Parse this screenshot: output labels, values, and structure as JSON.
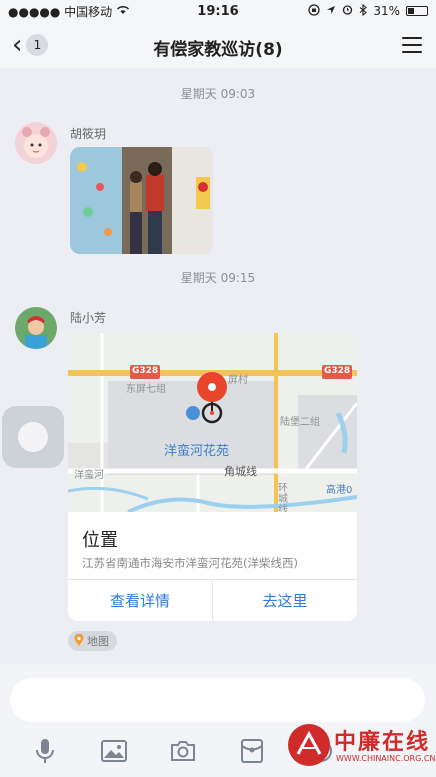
{
  "status_bar": {
    "carrier": "●●●●● 中国移动",
    "time": "19:16",
    "battery_text": "31%",
    "battery_level": 0.31
  },
  "nav": {
    "back_count": "1",
    "title": "有偿家教巡访(8)"
  },
  "messages": [
    {
      "time": "星期天 09:03",
      "sender": "胡筱玥",
      "type": "image"
    },
    {
      "time": "星期天 09:15",
      "sender": "陆小芳",
      "type": "location",
      "location": {
        "title": "位置",
        "address": "江苏省南通市海安市洋蛮河花苑(洋柴线西)",
        "view_details": "查看详情",
        "go_here": "去这里",
        "map_labels": {
          "road_1": "G328",
          "road_2": "G328",
          "village_1": "东屏七组",
          "village_2": "屏村",
          "poi": "洋蛮河花苑",
          "area_1": "陆堡二组",
          "area_2": "洋蛮河",
          "street_1": "角城线",
          "street_2": "环城线",
          "road_3": "高港0"
        }
      },
      "tag": "地图"
    }
  ],
  "input": {
    "placeholder": ""
  },
  "toolbar": [
    "microphone-icon",
    "image-icon",
    "camera-icon",
    "red-packet-icon",
    "emoji-icon"
  ],
  "watermark": {
    "name": "中廉在线",
    "url": "WWW.CHINAINC.ORG.CN"
  },
  "colors": {
    "accent": "#2e7ce0",
    "pin": "#e8452b",
    "watermark": "#d02b2b"
  }
}
